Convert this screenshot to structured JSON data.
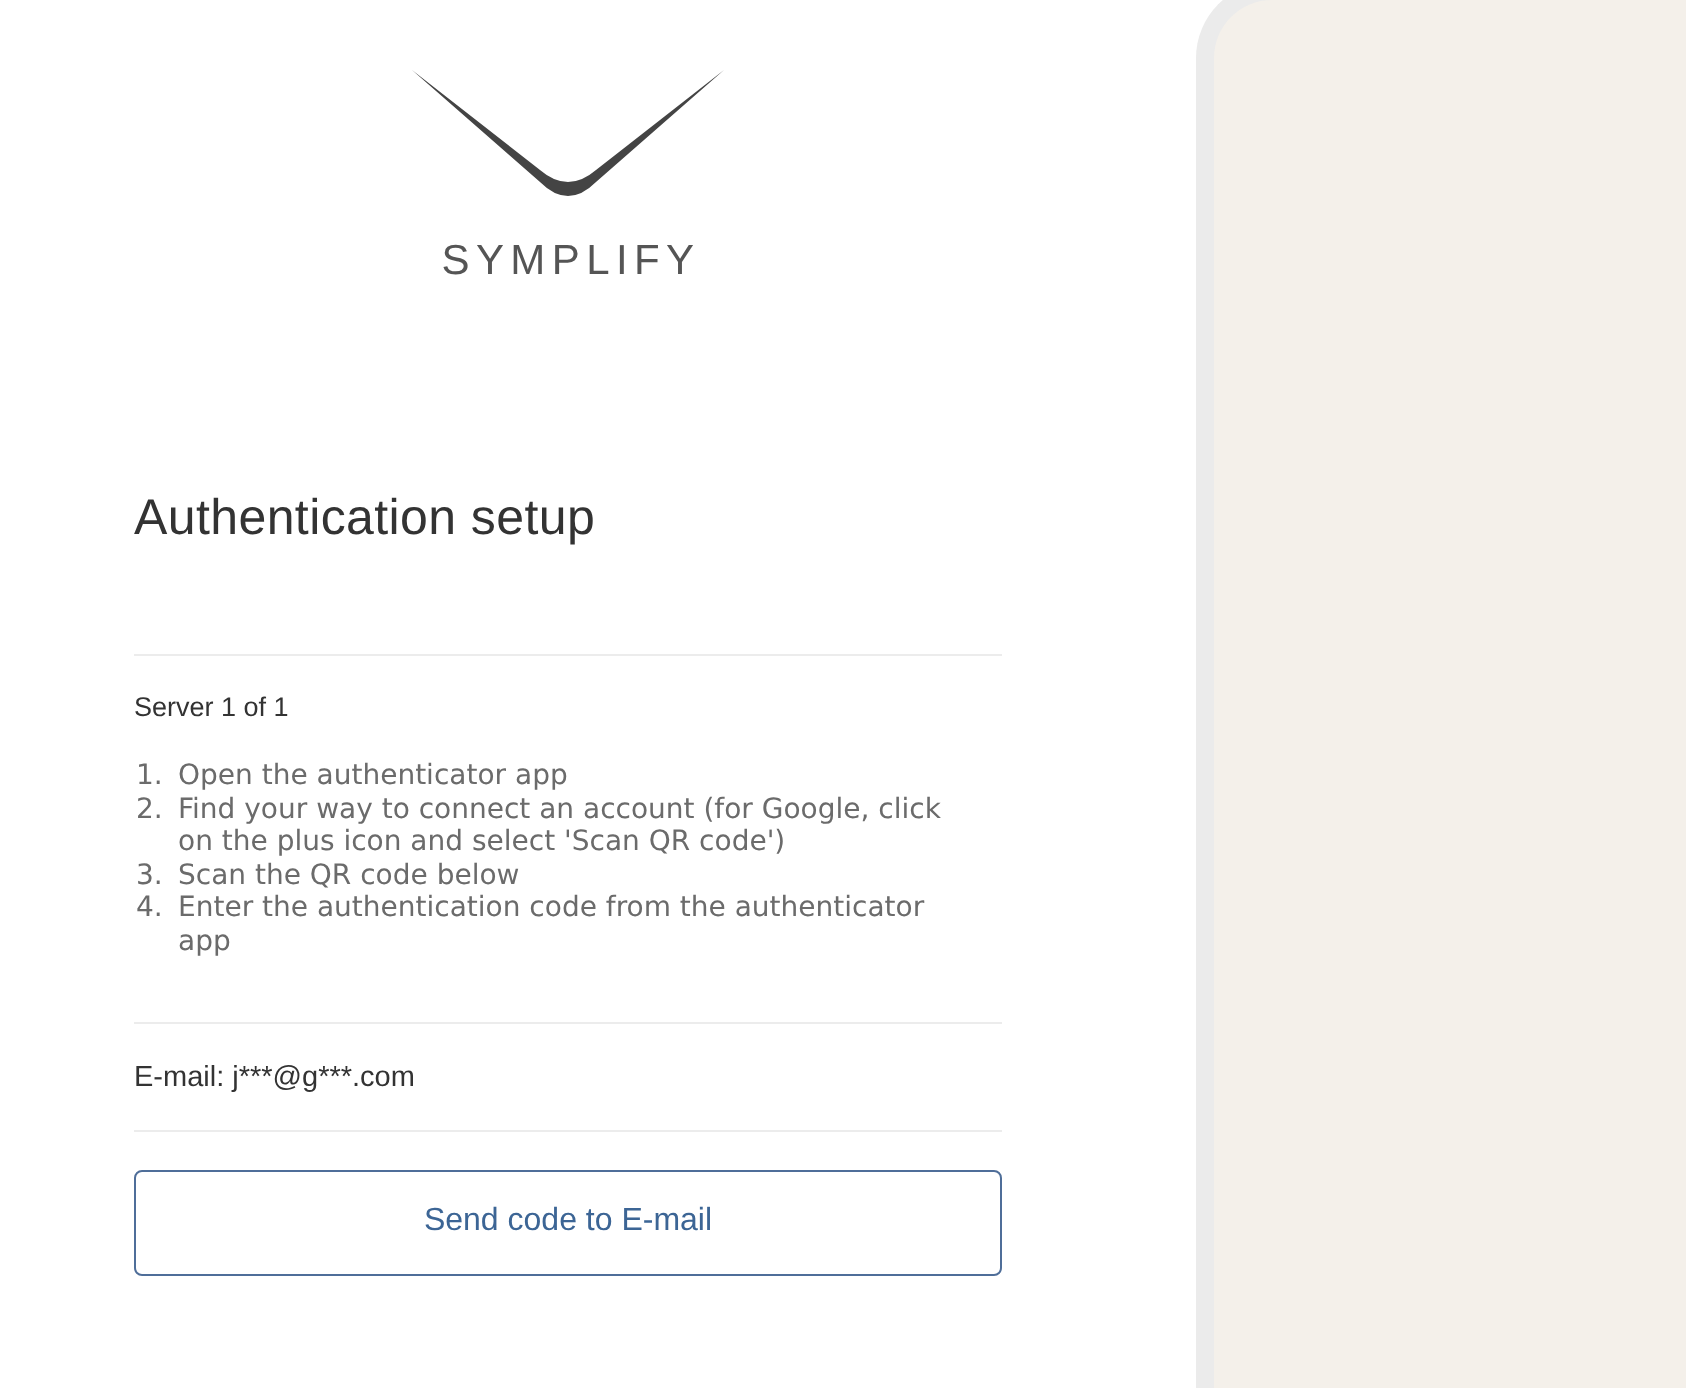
{
  "logo": {
    "wordmark": "SYMPLIFY"
  },
  "heading": "Authentication setup",
  "server_label": "Server 1 of 1",
  "steps": [
    {
      "number": "1.",
      "text": "Open the authenticator app"
    },
    {
      "number": "2.",
      "text": "Find your way to connect an account (for Google, click on the plus icon and select 'Scan QR code')"
    },
    {
      "number": "3.",
      "text": "Scan the QR code below"
    },
    {
      "number": "4.",
      "text": "Enter the authentication code from the authenticator app"
    }
  ],
  "email": "E-mail: j***@g***.com",
  "button": "Send code to E-mail"
}
